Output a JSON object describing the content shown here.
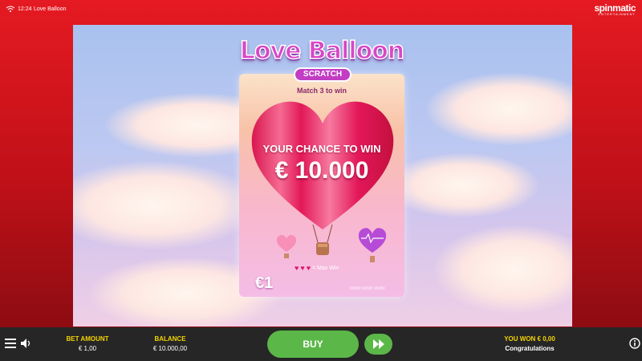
{
  "status_bar": {
    "time": "12:24",
    "app_title": "Love Balloon"
  },
  "brand": {
    "logo": "spinmatic",
    "logo_tag": "ENTERTAINMENT"
  },
  "game": {
    "title": "Love Balloon",
    "subtitle": "SCRATCH",
    "instruction": "Match 3 to win",
    "chance_text": "YOUR CHANCE TO WIN",
    "prize": "€ 10.000",
    "max_win_label": "= Max Win",
    "ticket_price": "€1",
    "serial": "0000 0000 0000"
  },
  "footer": {
    "bet_label": "BET AMOUNT",
    "bet_value": "€ 1,00",
    "balance_label": "BALANCE",
    "balance_value": "€ 10.000,00",
    "buy_label": "BUY",
    "win_label": "YOU WON € 0,00",
    "win_message": "Congratulations"
  },
  "icons": [
    "wifi-icon",
    "menu-icon",
    "sound-icon",
    "fast-forward-icon",
    "info-icon"
  ],
  "colors": {
    "frame_red": "#d0161e",
    "buy_green": "#5bb748",
    "label_yellow": "#f4d400",
    "title_pink": "#d946c8"
  }
}
